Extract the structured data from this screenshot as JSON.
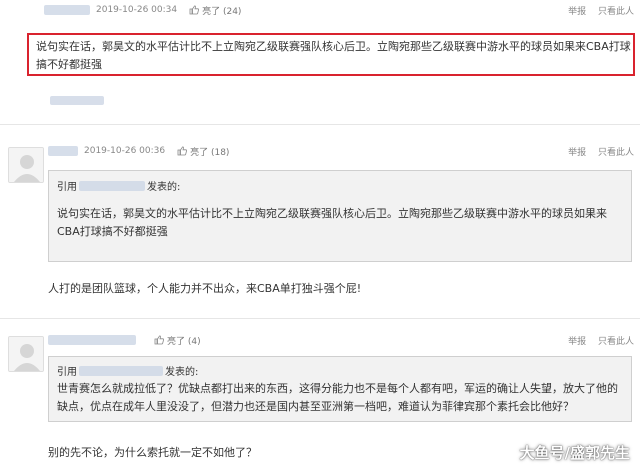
{
  "comments": [
    {
      "time": "2019-10-26 00:34",
      "like": "亮了 (24)",
      "text": "说句实在话，郭昊文的水平估计比不上立陶宛乙级联赛强队核心后卫。立陶宛那些乙级联赛中游水平的球员如果来CBA打球搞不好都挺强"
    },
    {
      "time": "2019-10-26 00:36",
      "like": "亮了 (18)",
      "quote_prefix": "引用",
      "quote_suffix": "发表的:",
      "quote_text": "说句实在话，郭昊文的水平估计比不上立陶宛乙级联赛强队核心后卫。立陶宛那些乙级联赛中游水平的球员如果来CBA打球搞不好都挺强",
      "text": "人打的是团队篮球，个人能力并不出众，来CBA单打独斗强个屁!"
    },
    {
      "time": "",
      "like": "亮了 (4)",
      "quote_prefix": "引用",
      "quote_suffix": "发表的:",
      "quote_text": "世青赛怎么就成拉低了？优缺点都打出来的东西，这得分能力也不是每个人都有吧，军运的确让人失望，放大了他的缺点，优点在成年人里没没了，但潜力也还是国内甚至亚洲第一档吧，难道认为菲律宾那个素托会比他好？",
      "text": "别的先不论，为什么索托就一定不如他了？"
    }
  ],
  "actions": {
    "report": "举报",
    "only_this": "只看此人"
  },
  "watermark": "大鱼号/盛郭先生",
  "colors": {
    "highlight_border": "#d9232e",
    "quote_bg": "#f2f2f2"
  }
}
